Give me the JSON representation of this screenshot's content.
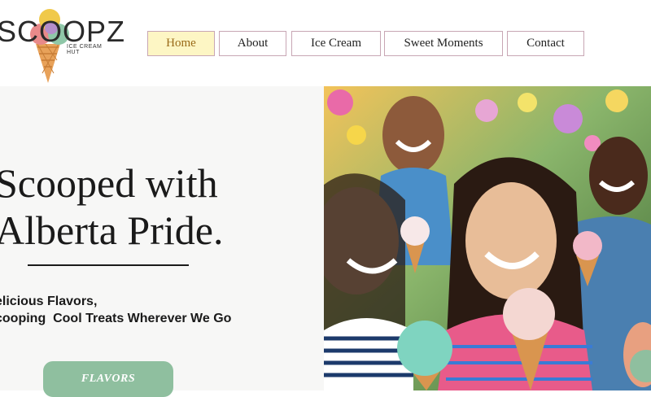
{
  "logo": {
    "brand": "SCOOPZ",
    "tagline": "ICE CREAM HUT"
  },
  "nav": {
    "items": [
      {
        "label": "Home",
        "active": true
      },
      {
        "label": "About",
        "active": false
      },
      {
        "label": "Ice Cream",
        "active": false
      },
      {
        "label": "Sweet Moments",
        "active": false
      },
      {
        "label": "Contact",
        "active": false
      }
    ]
  },
  "hero": {
    "title_line1": "Scooped with",
    "title_line2": "Alberta Pride.",
    "tagline_line1": "elicious Flavors,",
    "tagline_line2": "cooping  Cool Treats Wherever We Go",
    "cta_label": "FLAVORS"
  },
  "colors": {
    "accent_green": "#8fbf9f",
    "active_nav_bg": "#fdf6c4",
    "nav_border": "#c8a6b4"
  }
}
